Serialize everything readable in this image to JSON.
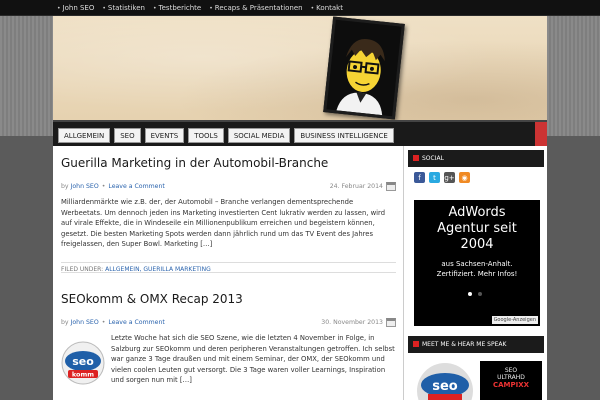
{
  "topnav": {
    "items": [
      {
        "label": "John SEO"
      },
      {
        "label": "Statistiken"
      },
      {
        "label": "Testberichte"
      },
      {
        "label": "Recaps & Präsentationen"
      },
      {
        "label": "Kontakt"
      }
    ]
  },
  "categories": [
    "ALLGEMEIN",
    "SEO",
    "EVENTS",
    "TOOLS",
    "SOCIAL MEDIA",
    "BUSINESS INTELLIGENCE"
  ],
  "posts": [
    {
      "title": "Guerilla Marketing in der Automobil-Branche",
      "by": "by",
      "author": "John SEO",
      "sep": "•",
      "comment": "Leave a Comment",
      "date": "24. Februar 2014",
      "excerpt": "Milliardenmärkte wie z.B. der, der Automobil – Branche verlangen dementsprechende Werbeetats. Um dennoch jeden ins Marketing investierten Cent lukrativ werden zu lassen, wird auf virale Effekte, die in Windeseile ein Millionenpublikum erreichen und begeistern können, gesetzt. Die besten Marketing Spots werden dann jährlich rund um das TV Event des Jahres freigelassen, den Super Bowl. Marketing […]",
      "filed_label": "FILED UNDER:",
      "filed_cats": "ALLGEMEIN, GUERILLA MARKETING"
    },
    {
      "title": "SEOkomm & OMX Recap 2013",
      "by": "by",
      "author": "John SEO",
      "sep": "•",
      "comment": "Leave a Comment",
      "date": "30. November 2013",
      "excerpt": "Letzte Woche hat sich die SEO Szene, wie die letzten 4 November in Folge, in Salzburg zur SEOkomm und deren peripheren Veranstaltungen getroffen. Ich selbst war ganze 3 Tage draußen und mit einem Seminar, der OMX, der SEOkomm und vielen coolen Leuten gut versorgt. Die 3 Tage waren voller Learnings, Inspiration und sorgen nun mit […]",
      "logo_seo": "seo",
      "logo_komm": "komm"
    }
  ],
  "sidebar": {
    "social_title": "SOCIAL",
    "social_icons": [
      {
        "icon": "facebook-icon",
        "glyph": "f",
        "color": "#3b5998"
      },
      {
        "icon": "twitter-icon",
        "glyph": "t",
        "color": "#29a9e1"
      },
      {
        "icon": "googleplus-icon",
        "glyph": "g+",
        "color": "#555555"
      },
      {
        "icon": "rss-icon",
        "glyph": "◉",
        "color": "#f08a24"
      }
    ],
    "ad": {
      "line1": "AdWords",
      "line2": "Agentur seit",
      "line3": "2004",
      "line4": "aus Sachsen-Anhalt.",
      "line5": "Zertifiziert. Mehr Infos!",
      "badge": "Google-Anzeigen"
    },
    "meet_title": "MEET ME & HEAR ME SPEAK",
    "meet2_l1": "SEO",
    "meet2_l2": "ULTRAHD",
    "meet2_l3": "CAMPIXX"
  },
  "colors": {
    "accent_red": "#d22222",
    "link_blue": "#2a63ad"
  }
}
